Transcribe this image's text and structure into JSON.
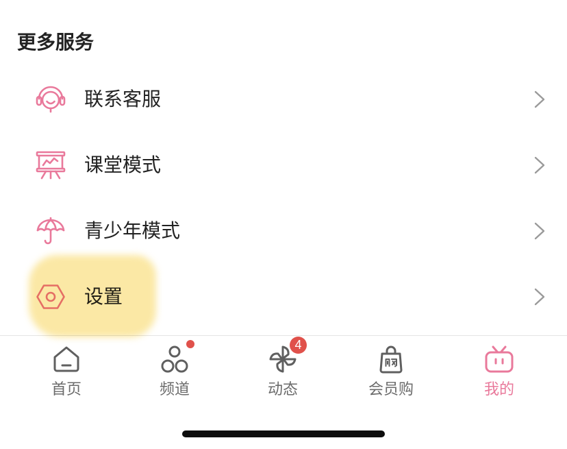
{
  "section": {
    "title": "更多服务"
  },
  "menu": {
    "items": [
      {
        "label": "联系客服",
        "icon": "headset-icon"
      },
      {
        "label": "课堂模式",
        "icon": "presentation-board-icon"
      },
      {
        "label": "青少年模式",
        "icon": "umbrella-icon"
      },
      {
        "label": "设置",
        "icon": "settings-hexagon-icon",
        "highlighted": true
      }
    ]
  },
  "tabbar": {
    "tabs": [
      {
        "label": "首页",
        "icon": "home-icon"
      },
      {
        "label": "频道",
        "icon": "channels-icon",
        "dot": true
      },
      {
        "label": "动态",
        "icon": "pinwheel-icon",
        "badge": "4"
      },
      {
        "label": "会员购",
        "icon": "shopping-bag-icon"
      },
      {
        "label": "我的",
        "icon": "tv-icon",
        "active": true
      }
    ]
  },
  "colors": {
    "accent": "#e9799b",
    "text": "#222222",
    "tab-text": "#6b6b6b",
    "badge": "#e0514b",
    "highlight": "#fbe7a0"
  }
}
